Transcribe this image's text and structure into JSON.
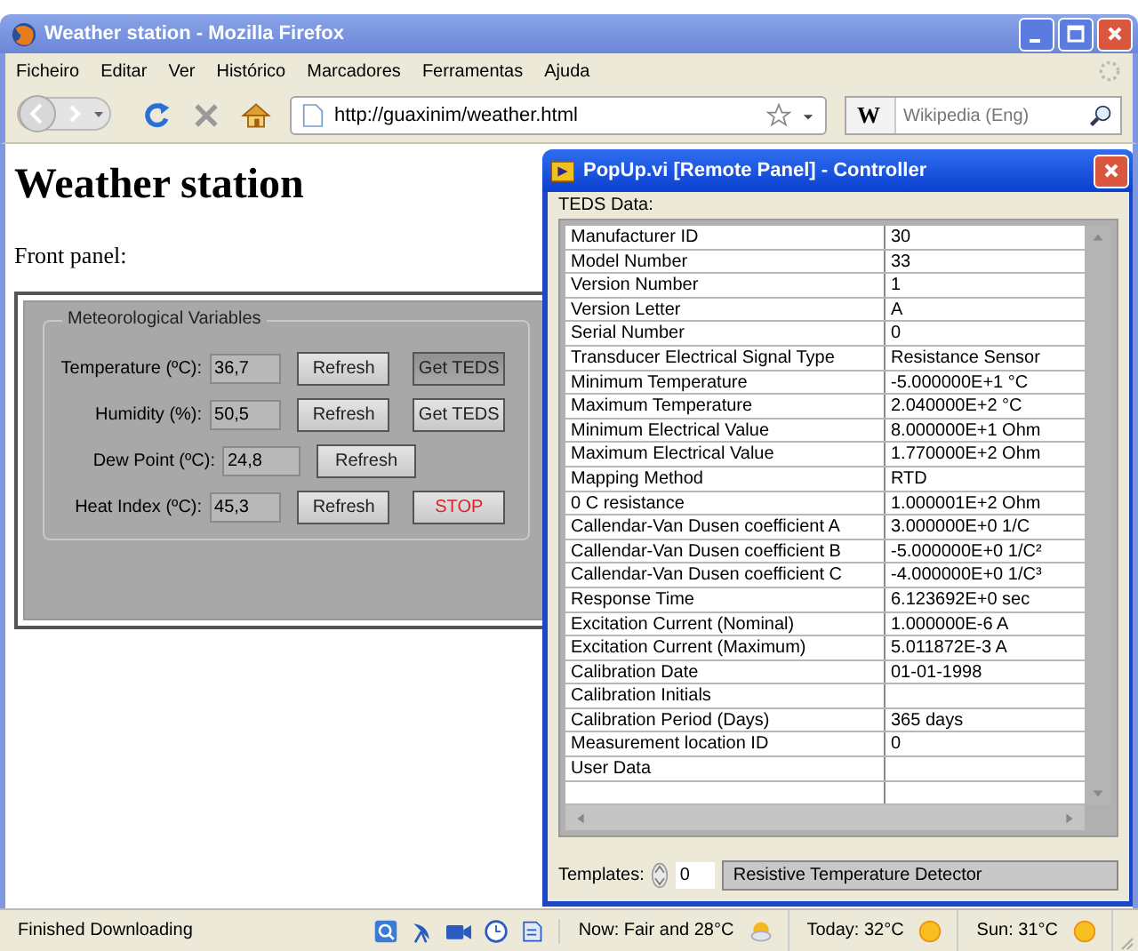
{
  "browser": {
    "title": "Weather station - Mozilla Firefox",
    "menu": [
      "Ficheiro",
      "Editar",
      "Ver",
      "Histórico",
      "Marcadores",
      "Ferramentas",
      "Ajuda"
    ],
    "url": "http://guaxinim/weather.html",
    "search_engine": "W",
    "search_placeholder": "Wikipedia (Eng)"
  },
  "page": {
    "heading": "Weather station",
    "intro": "Front panel:",
    "panel": {
      "group_title": "Meteorological Variables",
      "rows": [
        {
          "label": "Temperature (ºC):",
          "value": "36,7",
          "buttons": [
            {
              "label": "Refresh",
              "kind": "normal",
              "pressed": false
            },
            {
              "label": "Get TEDS",
              "kind": "normal",
              "pressed": true
            }
          ]
        },
        {
          "label": "Humidity (%):",
          "value": "50,5",
          "buttons": [
            {
              "label": "Refresh",
              "kind": "normal",
              "pressed": false
            },
            {
              "label": "Get TEDS",
              "kind": "normal",
              "pressed": false
            }
          ]
        },
        {
          "label": "Dew Point (ºC):",
          "value": "24,8",
          "buttons": [
            {
              "label": "Refresh",
              "kind": "normal",
              "pressed": false
            }
          ]
        },
        {
          "label": "Heat Index (ºC):",
          "value": "45,3",
          "buttons": [
            {
              "label": "Refresh",
              "kind": "normal",
              "pressed": false
            },
            {
              "label": "STOP",
              "kind": "stop",
              "pressed": false
            }
          ]
        }
      ]
    }
  },
  "popup": {
    "title": "PopUp.vi [Remote Panel] - Controller",
    "section_label": "TEDS Data:",
    "rows": [
      [
        "Manufacturer ID",
        "30"
      ],
      [
        "Model Number",
        "33"
      ],
      [
        "Version Number",
        "1"
      ],
      [
        "Version Letter",
        "A"
      ],
      [
        "Serial Number",
        "0"
      ],
      [
        "Transducer Electrical Signal Type",
        "Resistance Sensor"
      ],
      [
        "Minimum Temperature",
        "-5.000000E+1 °C"
      ],
      [
        "Maximum Temperature",
        "2.040000E+2 °C"
      ],
      [
        "Minimum Electrical Value",
        "8.000000E+1 Ohm"
      ],
      [
        "Maximum Electrical Value",
        "1.770000E+2 Ohm"
      ],
      [
        "Mapping Method",
        "RTD"
      ],
      [
        "0 C resistance",
        "1.000001E+2 Ohm"
      ],
      [
        "Callendar-Van Dusen coefficient A",
        "3.000000E+0 1/C"
      ],
      [
        "Callendar-Van Dusen coefficient B",
        "-5.000000E+0 1/C²"
      ],
      [
        "Callendar-Van Dusen coefficient C",
        "-4.000000E+0 1/C³"
      ],
      [
        "Response Time",
        "6.123692E+0 sec"
      ],
      [
        "Excitation Current (Nominal)",
        "1.000000E-6 A"
      ],
      [
        "Excitation Current (Maximum)",
        "5.011872E-3 A"
      ],
      [
        "Calibration Date",
        "01-01-1998"
      ],
      [
        "Calibration Initials",
        ""
      ],
      [
        "Calibration Period (Days)",
        "365 days"
      ],
      [
        "Measurement location ID",
        "0"
      ],
      [
        "User Data",
        ""
      ]
    ],
    "templates_label": "Templates:",
    "templates_index": "0",
    "templates_value": "Resistive Temperature Detector"
  },
  "status_bar": {
    "text": "Finished Downloading",
    "weather": [
      {
        "text": "Now: Fair and 28°C",
        "kind": "partly-cloudy"
      },
      {
        "text": "Today: 32°C",
        "kind": "sun"
      },
      {
        "text": "Sun: 31°C",
        "kind": "sun"
      }
    ]
  }
}
